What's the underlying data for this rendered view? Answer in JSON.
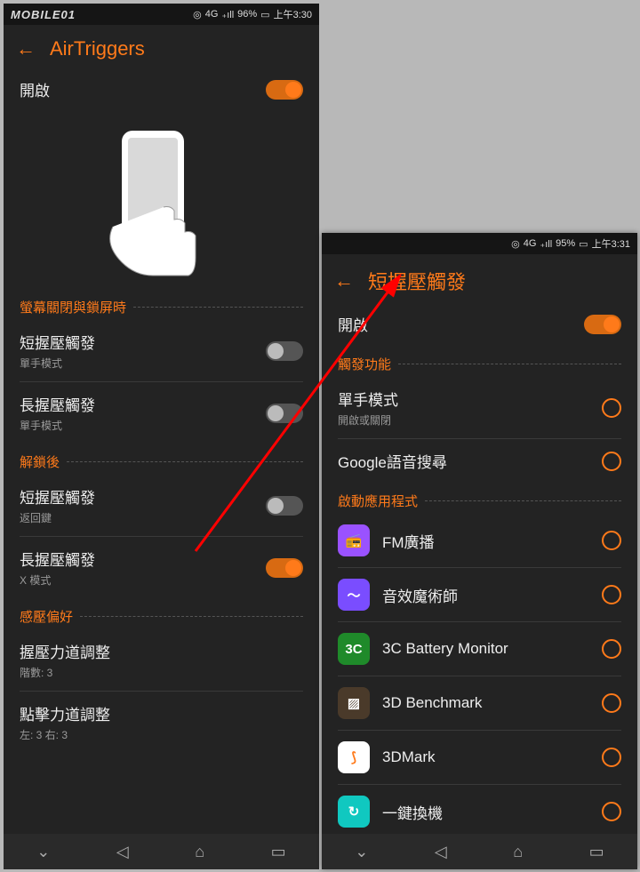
{
  "watermark": "MOBILE01",
  "colors": {
    "accent": "#ff7a1a"
  },
  "left": {
    "status": {
      "network": "4G",
      "signal": "₊ıll",
      "battery": "96%",
      "time": "上午3:30"
    },
    "title": "AirTriggers",
    "enable": {
      "label": "開啟",
      "on": true
    },
    "section_locked": "螢幕關閉與鎖屏時",
    "locked_items": [
      {
        "title": "短握壓觸發",
        "sub": "單手模式",
        "on": false
      },
      {
        "title": "長握壓觸發",
        "sub": "單手模式",
        "on": false
      }
    ],
    "section_unlocked": "解鎖後",
    "unlocked_items": [
      {
        "title": "短握壓觸發",
        "sub": "返回鍵",
        "on": false
      },
      {
        "title": "長握壓觸發",
        "sub": "X 模式",
        "on": true
      }
    ],
    "section_pressure": "感壓偏好",
    "pressure_items": [
      {
        "title": "握壓力道調整",
        "sub": "階數: 3"
      },
      {
        "title": "點擊力道調整",
        "sub": "左: 3 右: 3"
      }
    ]
  },
  "right": {
    "status": {
      "network": "4G",
      "signal": "₊ıll",
      "battery": "95%",
      "time": "上午3:31"
    },
    "title": "短握壓觸發",
    "enable": {
      "label": "開啟",
      "on": true
    },
    "section_trigger": "觸發功能",
    "trigger_items": [
      {
        "title": "單手模式",
        "sub": "開啟或關閉"
      },
      {
        "title": "Google語音搜尋",
        "sub": ""
      }
    ],
    "section_apps": "啟動應用程式",
    "apps": [
      {
        "name": "FM廣播",
        "icon_bg": "#9a52ff",
        "icon_txt": "📻"
      },
      {
        "name": "音效魔術師",
        "icon_bg": "#7a4dff",
        "icon_txt": "～"
      },
      {
        "name": "3C Battery Monitor",
        "icon_bg": "#1f8a2a",
        "icon_txt": "3C"
      },
      {
        "name": "3D Benchmark",
        "icon_bg": "#4a3a2a",
        "icon_txt": "▨"
      },
      {
        "name": "3DMark",
        "icon_bg": "#ffffff",
        "icon_txt": "⟆"
      },
      {
        "name": "一鍵換機",
        "icon_bg": "#10c8c0",
        "icon_txt": "↻"
      }
    ]
  }
}
